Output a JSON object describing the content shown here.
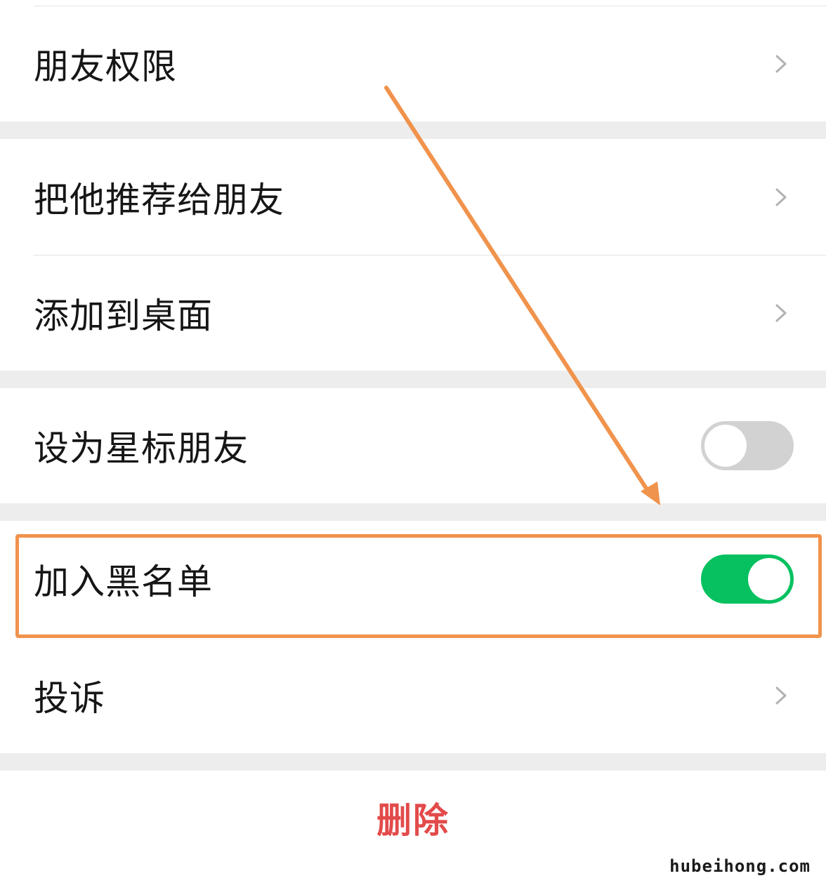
{
  "menu": {
    "friend_permissions": "朋友权限",
    "recommend_to_friends": "把他推荐给朋友",
    "add_to_desktop": "添加到桌面",
    "set_star_friend": "设为星标朋友",
    "add_to_blacklist": "加入黑名单",
    "complain": "投诉"
  },
  "toggles": {
    "star_friend": false,
    "blacklist": true
  },
  "delete_label": "删除",
  "watermark": "hubeihong.com",
  "colors": {
    "toggle_on": "#07c160",
    "toggle_off": "#d2d2d2",
    "delete_text": "#e34a4a",
    "annotation": "#f0934c",
    "section_gap": "#ededed"
  },
  "icons": {
    "chevron": "chevron-right-icon",
    "annotation_arrow": "arrow-icon"
  }
}
